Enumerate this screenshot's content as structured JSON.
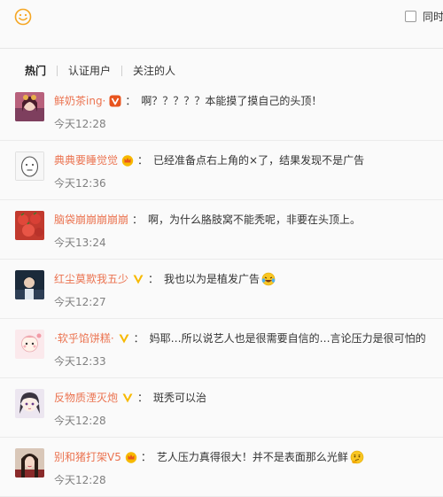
{
  "toolbar": {
    "emoji_icon": "smiley-face-icon",
    "sync_label": "同时"
  },
  "tabs": [
    {
      "label": "热门",
      "active": true
    },
    {
      "label": "认证用户",
      "active": false
    },
    {
      "label": "关注的人",
      "active": false
    }
  ],
  "comments": [
    {
      "username": "鲜奶茶ing·",
      "badge": "vip-v-icon",
      "colon": "：",
      "text": "啊？？？？？本能摸了摸自己的头顶！",
      "time": "今天12:28"
    },
    {
      "username": "典典要睡觉觉",
      "badge": "crown-member-icon",
      "colon": "：",
      "text": "已经准备点右上角的×了，结果发现不是广告",
      "time": "今天12:36"
    },
    {
      "username": "脑袋崩崩崩崩崩",
      "badge": "",
      "colon": "：",
      "text": "啊，为什么胳肢窝不能秃呢，非要在头顶上。",
      "time": "今天13:24"
    },
    {
      "username": "红尘莫欺我五少",
      "badge": "verified-v-icon",
      "colon": "：",
      "text": "我也以为是植发广告",
      "emoji": "laughing-tears-emoji",
      "time": "今天12:27"
    },
    {
      "username": "·软乎馅饼糕·",
      "badge": "verified-v-icon",
      "colon": "：",
      "text": "妈耶…所以说艺人也是很需要自信的…言论压力是很可怕的",
      "time": "今天12:33"
    },
    {
      "username": "反物质湮灭炮",
      "badge": "verified-v-icon",
      "colon": "：",
      "text": "斑秃可以治",
      "time": "今天12:28"
    },
    {
      "username": "别和猪打架V5",
      "badge": "crown-member-icon",
      "colon": "：",
      "text": "艺人压力真得很大！并不是表面那么光鲜",
      "emoji": "thinking-emoji",
      "time": "今天12:28"
    }
  ]
}
